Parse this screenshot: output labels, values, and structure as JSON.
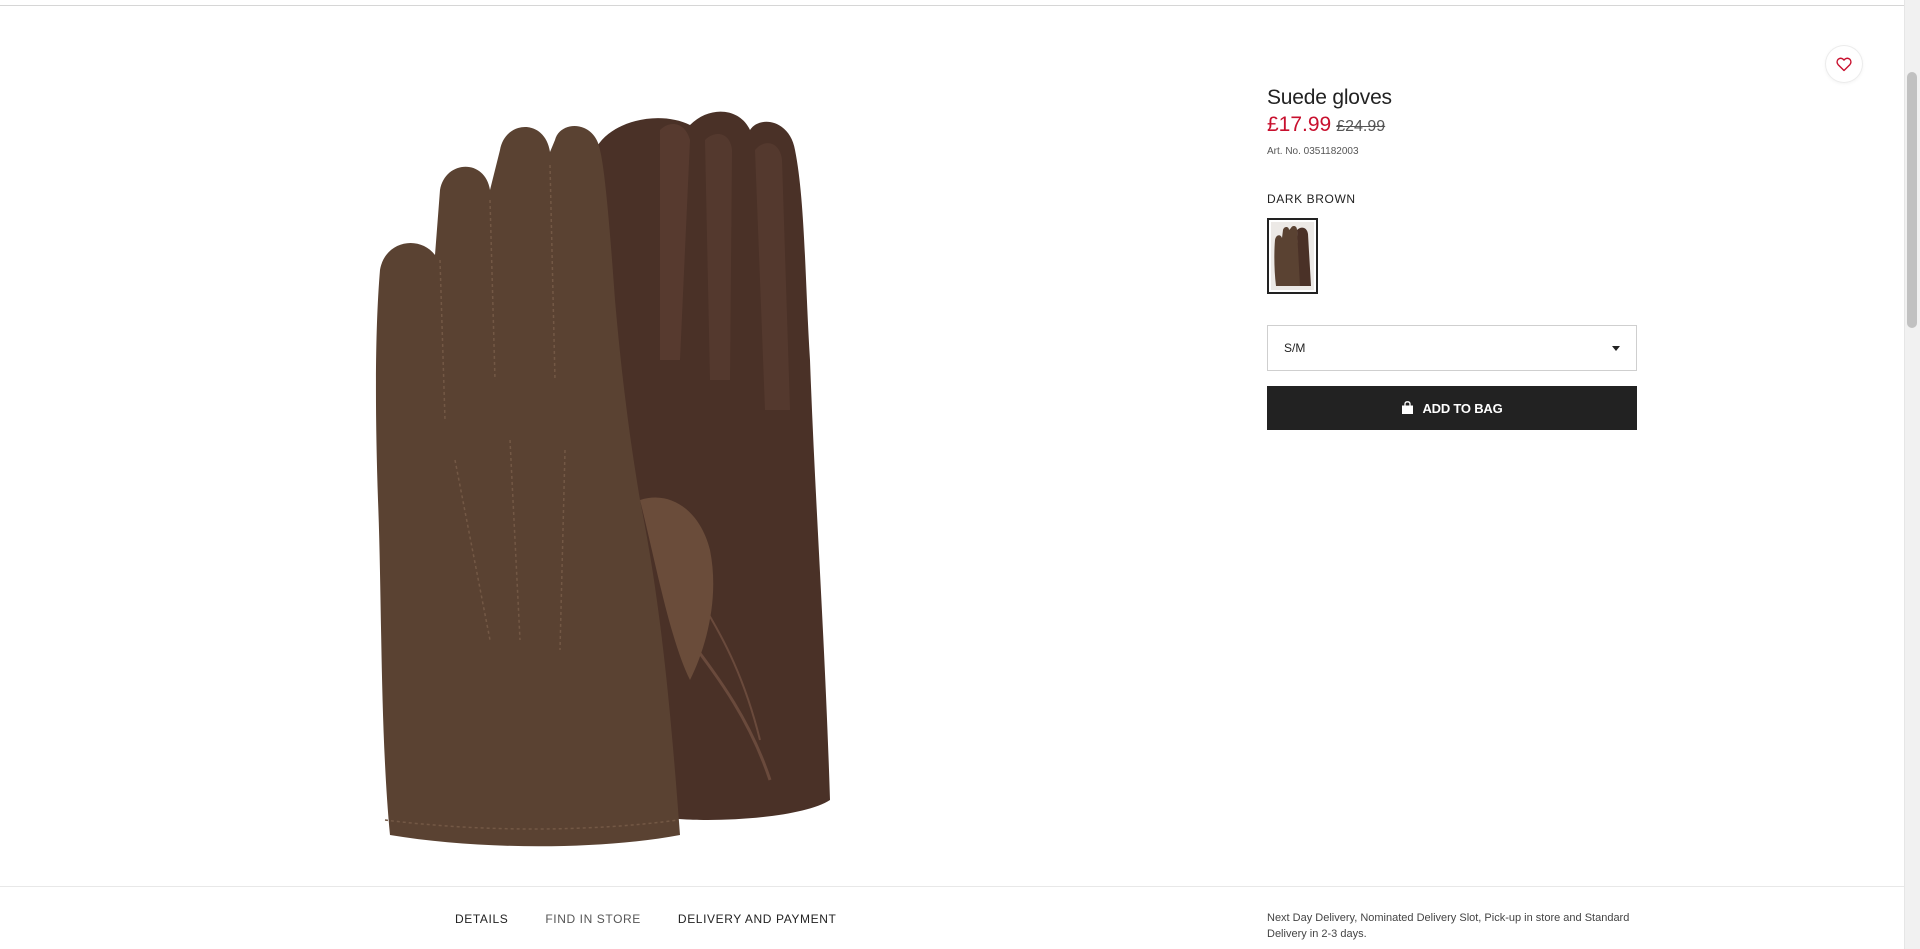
{
  "product": {
    "title": "Suede gloves",
    "price_sale": "£17.99",
    "price_original": "£24.99",
    "article_number": "Art. No. 0351182003",
    "color_name": "DARK BROWN",
    "size_selected": "S/M",
    "add_to_bag_label": "ADD TO BAG"
  },
  "tabs": [
    {
      "label": "DETAILS"
    },
    {
      "label": "FIND IN STORE"
    },
    {
      "label": "DELIVERY AND PAYMENT"
    }
  ],
  "delivery_info": "Next Day Delivery, Nominated Delivery Slot, Pick-up in store and Standard Delivery in 2-3 days.",
  "colors": {
    "sale_price": "#c8102e",
    "button_bg": "#222222",
    "glove_suede": "#5a4232",
    "glove_leather": "#4a3127"
  },
  "icons": {
    "favorite": "heart-icon",
    "bag": "shopping-bag-icon",
    "dropdown": "caret-down-icon"
  }
}
